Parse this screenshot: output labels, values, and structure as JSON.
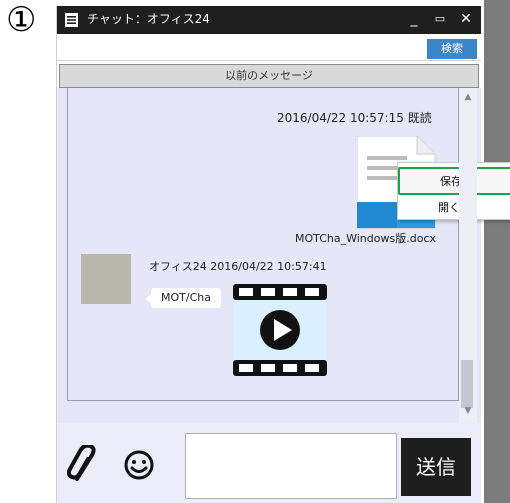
{
  "annotation": {
    "step_marker": "①"
  },
  "window": {
    "title": "チャット：オフィス24",
    "controls": {
      "minimize": "_",
      "maximize": "▭",
      "close": "✕"
    }
  },
  "search": {
    "value": "",
    "placeholder": "",
    "button_label": "検索"
  },
  "previous_messages_label": "以前のメッセージ",
  "messages": [
    {
      "timestamp": "2016/04/22 10:57:15",
      "status": "既読",
      "attachment": {
        "type": "docx",
        "filename": "MOTCha_Windows版.docx",
        "icon": "word-document-icon"
      }
    },
    {
      "sender": "オフィス24",
      "timestamp": "2016/04/22 10:57:41",
      "text": "MOT/Cha",
      "attachment": {
        "type": "video",
        "icon": "video-play-icon"
      }
    }
  ],
  "context_menu": {
    "items": [
      {
        "label": "保存",
        "highlighted": true
      },
      {
        "label": "開く"
      }
    ]
  },
  "composer": {
    "value": "",
    "send_label": "送信",
    "attach_icon": "paperclip-icon",
    "emoji_icon": "smiley-icon"
  },
  "colors": {
    "titlebar": "#1f1f1f",
    "accent": "#3a86c8",
    "chat_bg": "#e6e6f8",
    "highlight": "#22a04a",
    "word_blue": "#1f8ad1"
  }
}
